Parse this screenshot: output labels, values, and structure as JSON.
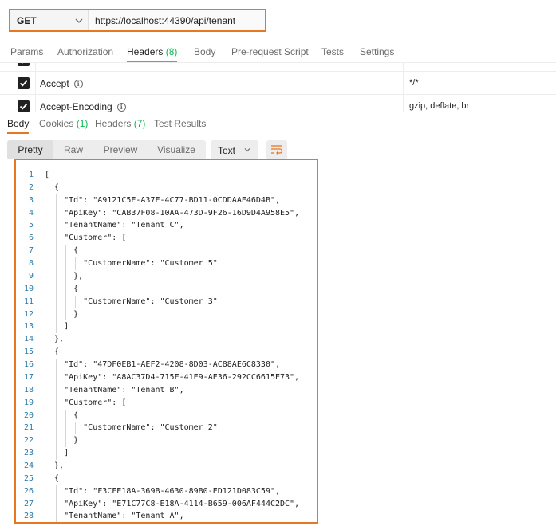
{
  "request": {
    "method": "GET",
    "url": "https://localhost:44390/api/tenant"
  },
  "request_tabs": {
    "params": "Params",
    "authorization": "Authorization",
    "headers": "Headers",
    "headers_count": "(8)",
    "body": "Body",
    "pre_request": "Pre-request Script",
    "tests": "Tests",
    "settings": "Settings"
  },
  "headers": [
    {
      "key": "",
      "value": ""
    },
    {
      "key": "Accept",
      "value": "*/*"
    },
    {
      "key": "Accept-Encoding",
      "value": "gzip, deflate, br"
    }
  ],
  "response_tabs": {
    "body": "Body",
    "cookies": "Cookies",
    "cookies_count": "(1)",
    "headers": "Headers",
    "headers_count": "(7)",
    "test_results": "Test Results"
  },
  "view_modes": [
    "Pretty",
    "Raw",
    "Preview",
    "Visualize"
  ],
  "active_view": "Pretty",
  "format": "Text",
  "code_lines": [
    "[",
    "  {",
    "    \"Id\": \"A9121C5E-A37E-4C77-BD11-0CDDAAE46D4B\",",
    "    \"ApiKey\": \"CAB37F08-10AA-473D-9F26-16D9D4A958E5\",",
    "    \"TenantName\": \"Tenant C\",",
    "    \"Customer\": [",
    "      {",
    "        \"CustomerName\": \"Customer 5\"",
    "      },",
    "      {",
    "        \"CustomerName\": \"Customer 3\"",
    "      }",
    "    ]",
    "  },",
    "  {",
    "    \"Id\": \"47DF0EB1-AEF2-4208-8D03-AC88AE6C8330\",",
    "    \"ApiKey\": \"A8AC37D4-715F-41E9-AE36-292CC6615E73\",",
    "    \"TenantName\": \"Tenant B\",",
    "    \"Customer\": [",
    "      {",
    "        \"CustomerName\": \"Customer 2\"",
    "      }",
    "    ]",
    "  },",
    "  {",
    "    \"Id\": \"F3CFE18A-369B-4630-89B0-ED121D083C59\",",
    "    \"ApiKey\": \"E71C77C8-E18A-4114-B659-006AF444C2DC\",",
    "    \"TenantName\": \"Tenant A\","
  ],
  "highlighted_line": 21
}
